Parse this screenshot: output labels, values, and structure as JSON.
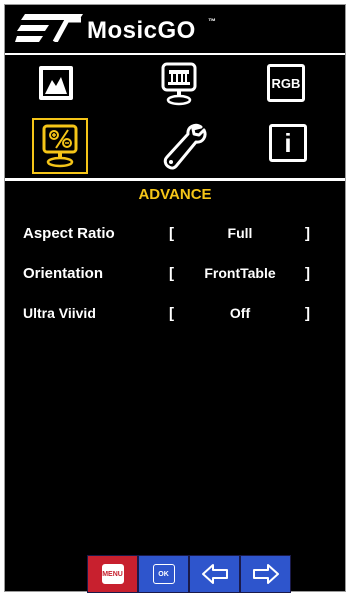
{
  "brand": {
    "name": "MosicGO",
    "trademark": "™"
  },
  "tabs": [
    {
      "id": "picture",
      "icon": "picture-icon",
      "label": ""
    },
    {
      "id": "display",
      "icon": "monitor-icon",
      "label": ""
    },
    {
      "id": "rgb",
      "icon": "rgb-icon",
      "label": "RGB"
    },
    {
      "id": "advance",
      "icon": "advance-icon",
      "label": "",
      "selected": true
    },
    {
      "id": "setup",
      "icon": "wrench-icon",
      "label": ""
    },
    {
      "id": "info",
      "icon": "info-icon",
      "label": "i"
    }
  ],
  "menu": {
    "title": "ADVANCE",
    "open_bracket": "[",
    "close_bracket": "]",
    "items": [
      {
        "label": "Aspect Ratio",
        "value": "Full"
      },
      {
        "label": "Orientation",
        "value": "FrontTable"
      },
      {
        "label": "Ultra Viivid",
        "value": "Off"
      }
    ]
  },
  "buttons": {
    "menu": "MENU",
    "ok": "OK",
    "left": "left-arrow-icon",
    "right": "right-arrow-icon"
  },
  "colors": {
    "background": "#000000",
    "highlight": "#f5c518",
    "menu_button": "#c8202e",
    "nav_button": "#2e55cc"
  }
}
